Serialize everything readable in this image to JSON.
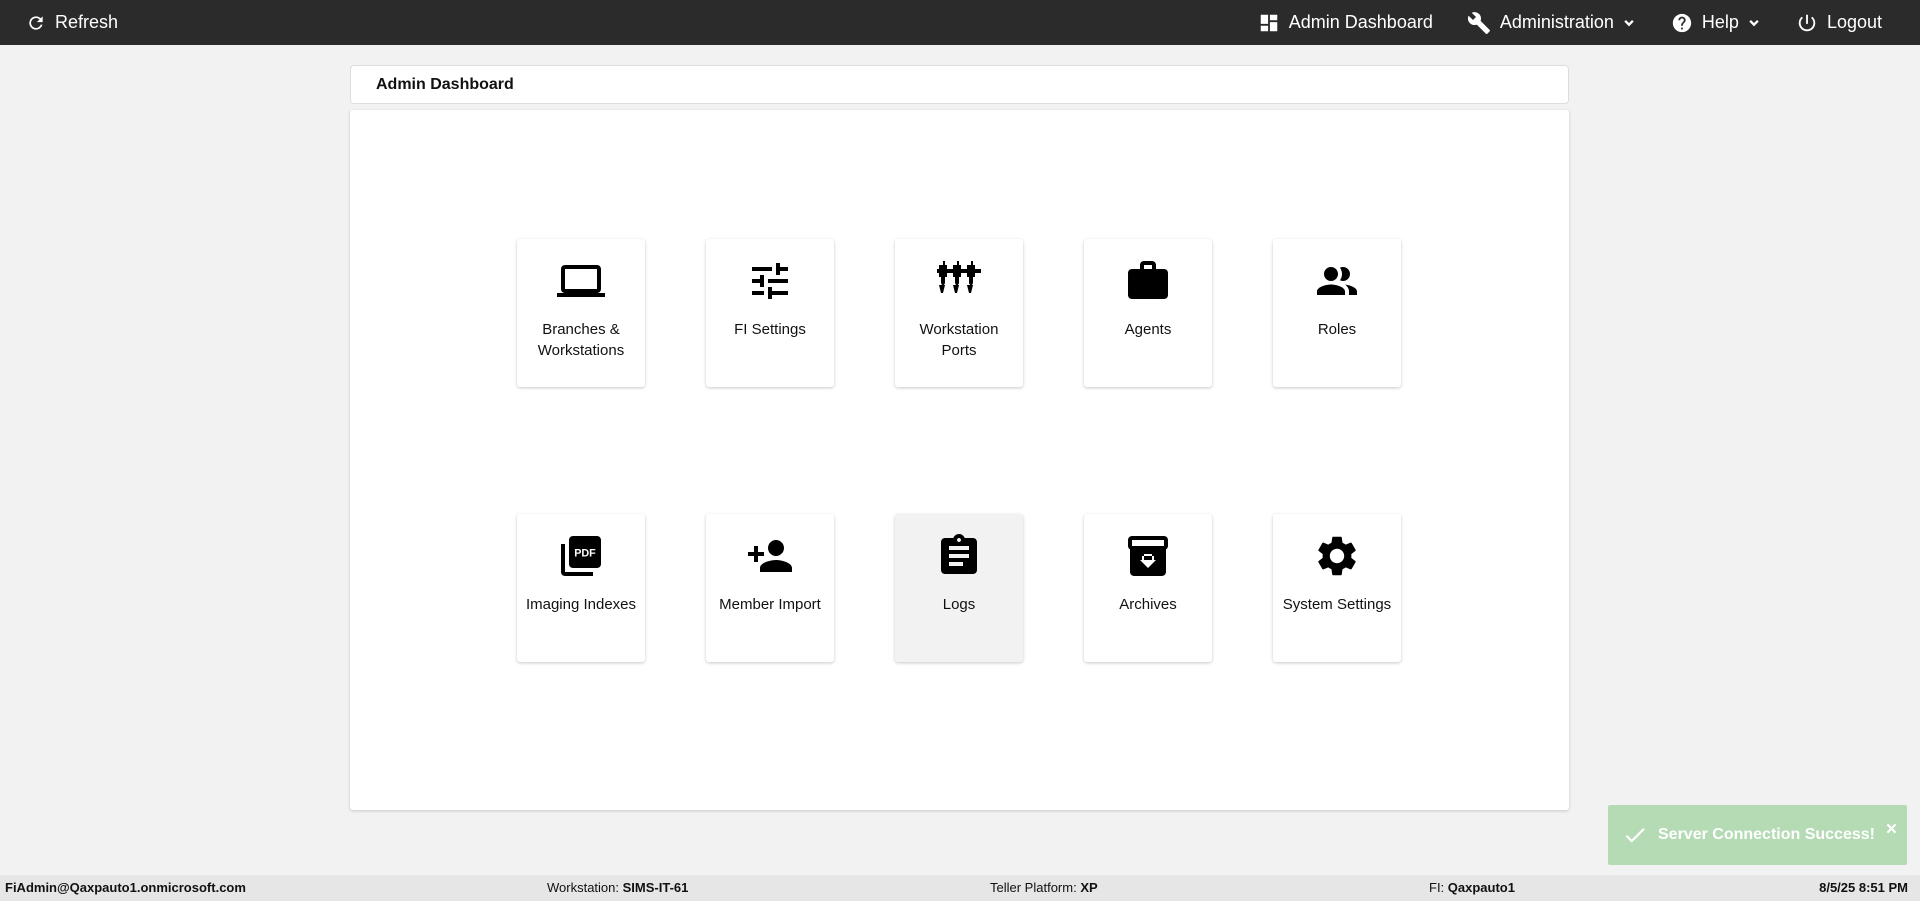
{
  "topbar": {
    "refresh_label": "Refresh",
    "nav": [
      {
        "label": "Admin Dashboard",
        "icon": "dashboard-icon"
      },
      {
        "label": "Administration",
        "icon": "wrench-icon"
      },
      {
        "label": "Help",
        "icon": "help-icon"
      },
      {
        "label": "Logout",
        "icon": "power-icon"
      }
    ]
  },
  "header": {
    "title": "Admin Dashboard"
  },
  "tiles": [
    {
      "label": "Branches & Workstations",
      "icon": "laptop-icon"
    },
    {
      "label": "FI Settings",
      "icon": "sliders-icon"
    },
    {
      "label": "Workstation Ports",
      "icon": "ports-icon"
    },
    {
      "label": "Agents",
      "icon": "briefcase-icon"
    },
    {
      "label": "Roles",
      "icon": "people-icon"
    },
    {
      "label": "Imaging Indexes",
      "icon": "pdf-icon"
    },
    {
      "label": "Member Import",
      "icon": "person-add-icon"
    },
    {
      "label": "Logs",
      "icon": "clipboard-icon"
    },
    {
      "label": "Archives",
      "icon": "archive-icon"
    },
    {
      "label": "System Settings",
      "icon": "gear-icon"
    }
  ],
  "statusbar": {
    "user": "FiAdmin@Qaxpauto1.onmicrosoft.com",
    "workstation_label": "Workstation:",
    "workstation_value": "SIMS-IT-61",
    "platform_label": "Teller Platform:",
    "platform_value": "XP",
    "fi_label": "FI:",
    "fi_value": "Qaxpauto1",
    "datetime": "8/5/25 8:51 PM"
  },
  "toast": {
    "message": "Server Connection Success!",
    "close": "×"
  },
  "colors": {
    "topbar": "#2b2b2b",
    "background": "#f2f2f2",
    "toast": "#b5dbb5"
  }
}
